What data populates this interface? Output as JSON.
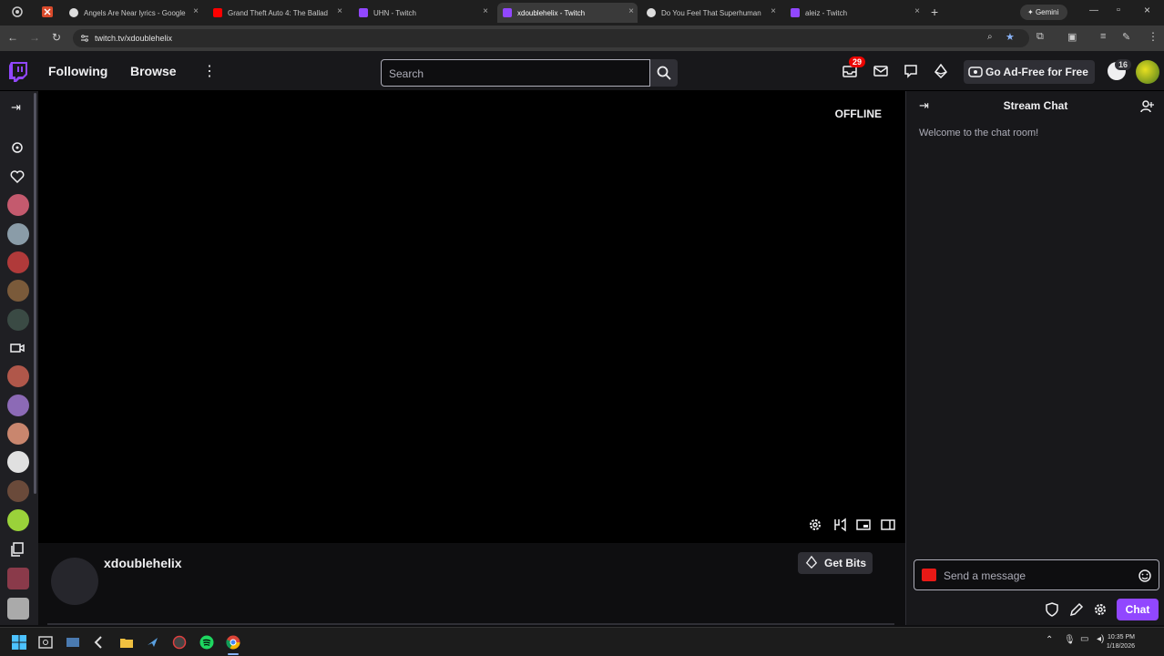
{
  "browser": {
    "tabs": [
      {
        "label": "Angels Are Near lyrics - Google",
        "favicon_color": "#dddddd",
        "active": false
      },
      {
        "label": "Grand Theft Auto 4: The Ballad",
        "favicon_color": "#ff0000",
        "active": false
      },
      {
        "label": "UHN - Twitch",
        "favicon_color": "#9147ff",
        "active": false
      },
      {
        "label": "xdoublehelix - Twitch",
        "favicon_color": "#9147ff",
        "active": true
      },
      {
        "label": "Do You Feel That Superhuman",
        "favicon_color": "#dddddd",
        "active": false
      },
      {
        "label": "aleiz - Twitch",
        "favicon_color": "#9147ff",
        "active": false
      }
    ],
    "gemini_label": "Gemini",
    "url": "twitch.tv/xdoublehelix"
  },
  "nav": {
    "following": "Following",
    "browse": "Browse",
    "search_placeholder": "Search",
    "notifications_count": "29",
    "bits_count": "16",
    "ad_free": "Go Ad-Free for Free"
  },
  "player": {
    "status": "OFFLINE"
  },
  "channel": {
    "name": "xdoublehelix",
    "get_bits": "Get Bits"
  },
  "chat": {
    "title": "Stream Chat",
    "welcome": "Welcome to the chat room!",
    "placeholder": "Send a message",
    "send_label": "Chat"
  },
  "taskbar": {
    "time": "10:35 PM",
    "date": "1/18/2026"
  },
  "colors": {
    "twitch_purple": "#9147ff",
    "background": "#0e0e10",
    "alert_red": "#eb0400"
  }
}
